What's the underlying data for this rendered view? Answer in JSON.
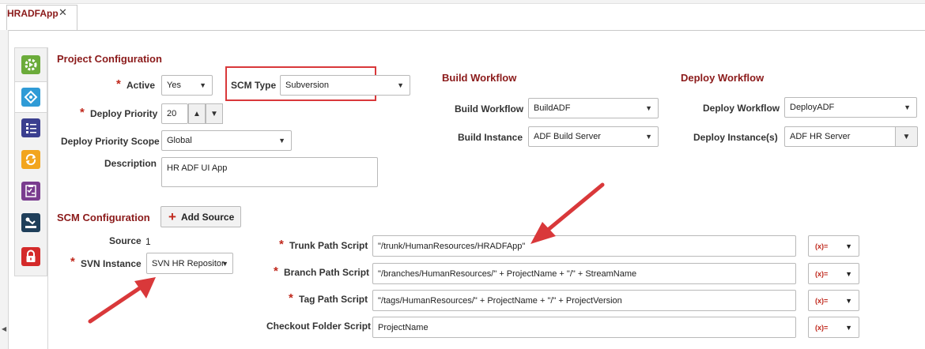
{
  "tab": {
    "label": "HRADFApp",
    "close": "✕"
  },
  "project_config": {
    "title": "Project Configuration",
    "required_mark": "*",
    "active": {
      "label": "Active",
      "value": "Yes"
    },
    "scm_type": {
      "label": "SCM Type",
      "value": "Subversion"
    },
    "deploy_priority": {
      "label": "Deploy Priority",
      "value": "20"
    },
    "deploy_priority_scope": {
      "label": "Deploy Priority Scope",
      "value": "Global"
    },
    "description": {
      "label": "Description",
      "value": "HR ADF UI App"
    }
  },
  "build_workflow": {
    "title": "Build Workflow",
    "workflow": {
      "label": "Build Workflow",
      "value": "BuildADF"
    },
    "instance": {
      "label": "Build Instance",
      "value": "ADF Build Server"
    }
  },
  "deploy_workflow": {
    "title": "Deploy Workflow",
    "workflow": {
      "label": "Deploy Workflow",
      "value": "DeployADF"
    },
    "instances": {
      "label": "Deploy Instance(s)",
      "value": "ADF HR Server"
    }
  },
  "scm_config": {
    "title": "SCM Configuration",
    "add_source_label": "Add Source",
    "source": {
      "label": "Source",
      "value": "1"
    },
    "svn_instance": {
      "label": "SVN Instance",
      "value": "SVN HR Repositor"
    },
    "trunk": {
      "label": "Trunk Path Script",
      "value": "\"/trunk/HumanResources/HRADFApp\""
    },
    "branch": {
      "label": "Branch Path Script",
      "value": "\"/branches/HumanResources/\" + ProjectName + \"/\" + StreamName"
    },
    "tag": {
      "label": "Tag Path Script",
      "value": "\"/tags/HumanResources/\" + ProjectName + \"/\" + ProjectVersion"
    },
    "checkout": {
      "label": "Checkout Folder Script",
      "value": "ProjectName"
    },
    "fx_label": "(x)="
  },
  "toolbar_icons": [
    "gear-play-icon",
    "workflow-icon",
    "list-icon",
    "refresh-icon",
    "checklist-icon",
    "robot-arm-icon",
    "lock-icon"
  ],
  "colors": {
    "section": "#8b1a1a",
    "required": "#c0281c",
    "annotation": "#d9383a"
  }
}
